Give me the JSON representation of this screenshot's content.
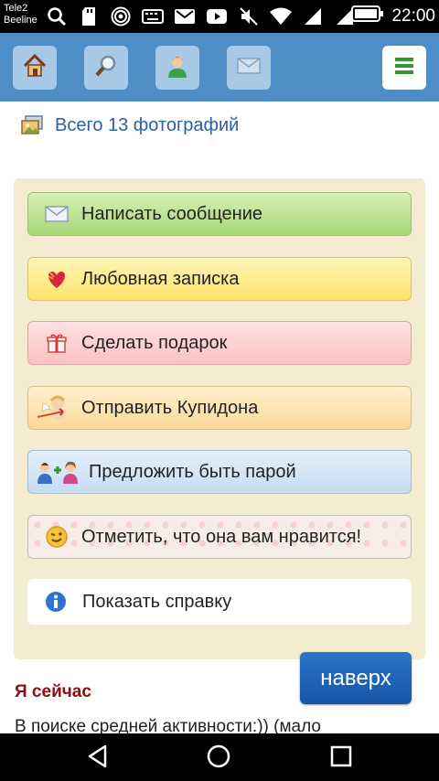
{
  "status_bar": {
    "carrier_1": "Tele2",
    "carrier_2": "Beeline",
    "time": "22:00",
    "icons": [
      "search-icon",
      "sd-card-icon",
      "hotspot-icon",
      "keyboard-icon",
      "gmail-icon",
      "youtube-icon",
      "mute-icon",
      "wifi-icon",
      "signal-icon",
      "signal-icon",
      "battery-icon"
    ]
  },
  "top_nav": {
    "buttons": [
      "home-icon",
      "search-icon",
      "profile-icon",
      "mail-icon"
    ],
    "menu": "menu-icon"
  },
  "photos": {
    "label": "Всего 13 фотографий"
  },
  "actions": {
    "write_message": "Написать сообщение",
    "love_note": "Любовная записка",
    "make_gift": "Сделать подарок",
    "send_cupid": "Отправить Купидона",
    "offer_pair": "Предложить быть парой",
    "mark_like": "Отметить, что она вам нравится!",
    "show_help": "Показать справку"
  },
  "profile": {
    "now_title": "Я сейчас",
    "now_text": "В поиске средней активности:)) (мало"
  },
  "scroll_top_button": "наверх",
  "colors": {
    "nav_blue": "#4d8ec6",
    "panel_bg": "#f3ecd0",
    "title_red": "#8b1010",
    "link_blue": "#2a5fa8"
  }
}
